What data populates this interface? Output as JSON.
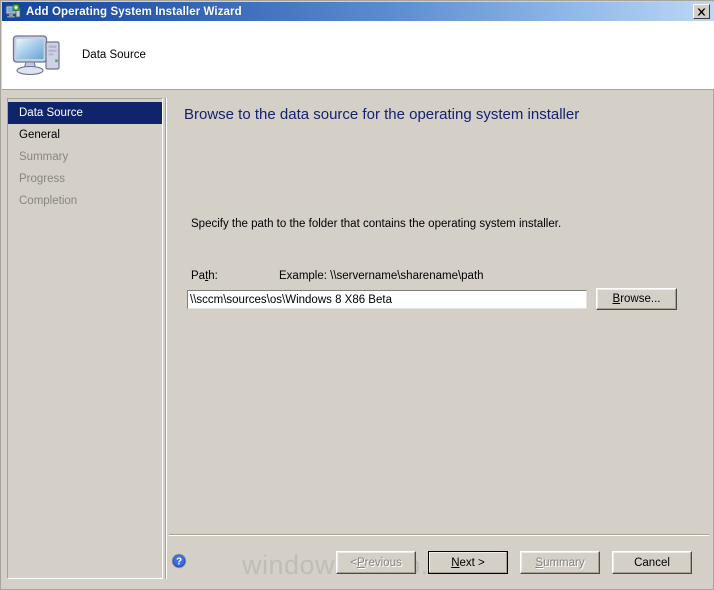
{
  "window": {
    "title": "Add Operating System Installer Wizard",
    "title_icon": "computer-add-icon",
    "close_label": "close-icon",
    "accent_titlebar_dark": "#13449c",
    "accent_titlebar_light": "#bcd8f5",
    "face_color": "#d4d0c8"
  },
  "header": {
    "icon": "computer-icon",
    "title": "Data Source"
  },
  "sidebar": {
    "items": [
      {
        "label": "Data Source",
        "state": "active"
      },
      {
        "label": "General",
        "state": "enabled"
      },
      {
        "label": "Summary",
        "state": "disabled"
      },
      {
        "label": "Progress",
        "state": "disabled"
      },
      {
        "label": "Completion",
        "state": "disabled"
      }
    ],
    "active_background": "#10246b",
    "active_text": "#ffffff",
    "disabled_text": "#888581"
  },
  "main": {
    "heading": "Browse to the data source for the operating system installer",
    "heading_color": "#17216e",
    "instruction": "Specify the path to the folder that contains the operating system installer.",
    "path_label_pre": "Pa",
    "path_label_accel": "t",
    "path_label_post": "h:",
    "path_example": "Example: \\\\servername\\sharename\\path",
    "path_value": "\\\\sccm\\sources\\os\\Windows 8 X86 Beta",
    "path_placeholder": "",
    "browse_accel": "B",
    "browse_rest": "rowse..."
  },
  "footer": {
    "help_icon": "help-question-icon",
    "watermark": "windows-noob.com",
    "buttons": [
      {
        "name": "previous",
        "pre": "< ",
        "accel": "P",
        "post": "revious",
        "state": "disabled",
        "default": false
      },
      {
        "name": "next",
        "pre": "",
        "accel": "N",
        "post": "ext >",
        "state": "enabled",
        "default": true
      },
      {
        "name": "summary",
        "pre": "",
        "accel": "S",
        "post": "ummary",
        "state": "disabled",
        "default": false
      },
      {
        "name": "cancel",
        "pre": "",
        "accel": "",
        "post": "Cancel",
        "state": "enabled",
        "default": false
      }
    ]
  }
}
